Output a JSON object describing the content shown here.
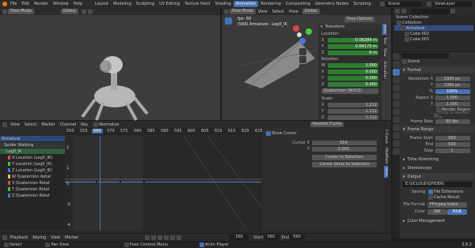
{
  "topbar": {
    "menus": [
      "File",
      "Edit",
      "Render",
      "Window",
      "Help"
    ],
    "workspaces": [
      "Layout",
      "Modeling",
      "Sculpting",
      "UV Editing",
      "Texture Paint",
      "Shading",
      "Animation",
      "Rendering",
      "Compositing",
      "Geometry Nodes",
      "Scripting"
    ],
    "active_workspace": "Animation",
    "scene": "Scene",
    "view_layer": "ViewLayer"
  },
  "left_viewport": {
    "mode": "Pose Mode",
    "transform": "Global"
  },
  "camera_view": {
    "mode": "Pose Mode",
    "menus": [
      "View",
      "Select",
      "Pose"
    ],
    "transform": "Global",
    "pose_options": "Pose Options",
    "fps": "fps: 60",
    "object_label": "(566) Armature : Leg0_IK"
  },
  "npanel": {
    "tabs": [
      "Item",
      "Tool",
      "View",
      "Animation"
    ],
    "section": "Transform",
    "location_label": "Location:",
    "location": [
      {
        "axis": "X",
        "value": "-0.06284 m"
      },
      {
        "axis": "Y",
        "value": "0.04175 m"
      },
      {
        "axis": "Z",
        "value": "0 m"
      }
    ],
    "rotation_label": "Rotation:",
    "rotation": [
      {
        "axis": "W",
        "value": "1.000"
      },
      {
        "axis": "X",
        "value": "0.000"
      },
      {
        "axis": "Y",
        "value": "0.000"
      },
      {
        "axis": "Z",
        "value": "0.000"
      }
    ],
    "rotation_mode": "Quaternion (WXYZ)",
    "scale_label": "Scale:",
    "scale": [
      {
        "axis": "X",
        "value": "1.212"
      },
      {
        "axis": "Y",
        "value": "1.212"
      },
      {
        "axis": "Z",
        "value": "1.212"
      }
    ]
  },
  "outliner": {
    "title": "Scene Collection",
    "items": [
      "Collection",
      "Armature",
      "Cube.002",
      "Cube.003"
    ]
  },
  "properties": {
    "scene_label": "Scene",
    "format": {
      "section": "Format",
      "res_x_label": "Resolution X",
      "res_x": "1920 px",
      "y_label": "Y",
      "res_y": "1080 px",
      "pct_label": "%",
      "pct": "100%",
      "aspect_x_label": "Aspect X",
      "aspect_x": "1.000",
      "aspect_y_label": "Y",
      "aspect_y": "1.000",
      "render_region": "Render Region",
      "crop": "Crop to Render R...",
      "frame_rate_label": "Frame Rate",
      "frame_rate": "60 fps"
    },
    "frame_range": {
      "section": "Frame Range",
      "start_label": "Frame Start",
      "start": "560",
      "end_label": "End",
      "end": "590",
      "step_label": "Step",
      "step": "1"
    },
    "time_stretching": "Time Stretching",
    "stereoscopy": "Stereoscopy",
    "output": {
      "section": "Output",
      "path": "E:\\UCLOUD\\SPIDER\\",
      "saving_label": "Saving",
      "file_extensions": "File Extensions",
      "cache_result": "Cache Result",
      "file_format_label": "File Format",
      "file_format": "FFmpeg Video",
      "color_label": "Color",
      "bw": "BW",
      "rgb": "RGB"
    },
    "color_management": "Color Management"
  },
  "graph_editor": {
    "menus": [
      "View",
      "Select",
      "Marker",
      "Channel",
      "Key"
    ],
    "normalize": "Normalize",
    "pivot": "Nearest Frame",
    "frame_labels": [
      "550",
      "555",
      "566",
      "570",
      "575",
      "580",
      "585",
      "590",
      "595",
      "600",
      "605",
      "610",
      "615",
      "620",
      "625"
    ],
    "current_frame": "566",
    "y_labels": [
      "2",
      "1",
      "0",
      "-2",
      "-4"
    ],
    "channels": [
      {
        "name": "Armature",
        "type": "header"
      },
      {
        "name": "Spider Walking",
        "type": "action"
      },
      {
        "name": "Leg0_IK",
        "type": "group"
      },
      {
        "name": "X Location (Leg0_IK)",
        "color": "#e04848"
      },
      {
        "name": "Y Location (Leg0_IK)",
        "color": "#48c048"
      },
      {
        "name": "Z Location (Leg0_IK)",
        "color": "#4870e0"
      },
      {
        "name": "W Quaternion Rotat",
        "color": "#e0c848"
      },
      {
        "name": "X Quaternion Rotat",
        "color": "#e04848"
      },
      {
        "name": "Y Quaternion Rotat",
        "color": "#48c048"
      },
      {
        "name": "Z Quaternion Rotat",
        "color": "#4870e0"
      }
    ],
    "sidebar_tabs": [
      "F-Curve",
      "Modifiers",
      "View"
    ],
    "show_cursor": "Show Cursor",
    "cursor_x_label": "Cursor X",
    "cursor_x": "558",
    "cursor_y_label": "Y",
    "cursor_y": "0.000",
    "cursor_to_selection": "Cursor to Selection",
    "cursor_value_to_selection": "Cursor Value to Selection"
  },
  "timeline": {
    "menus": [
      "Playback",
      "Keying",
      "View",
      "Marker"
    ],
    "current": "566",
    "start_label": "Start",
    "start": "560",
    "end_label": "End",
    "end": "590"
  },
  "statusbar": {
    "select": "Select",
    "pan": "Pan View",
    "context": "Pose Context Menu",
    "anim_player": "Anim Player",
    "version": "3.6.2"
  }
}
